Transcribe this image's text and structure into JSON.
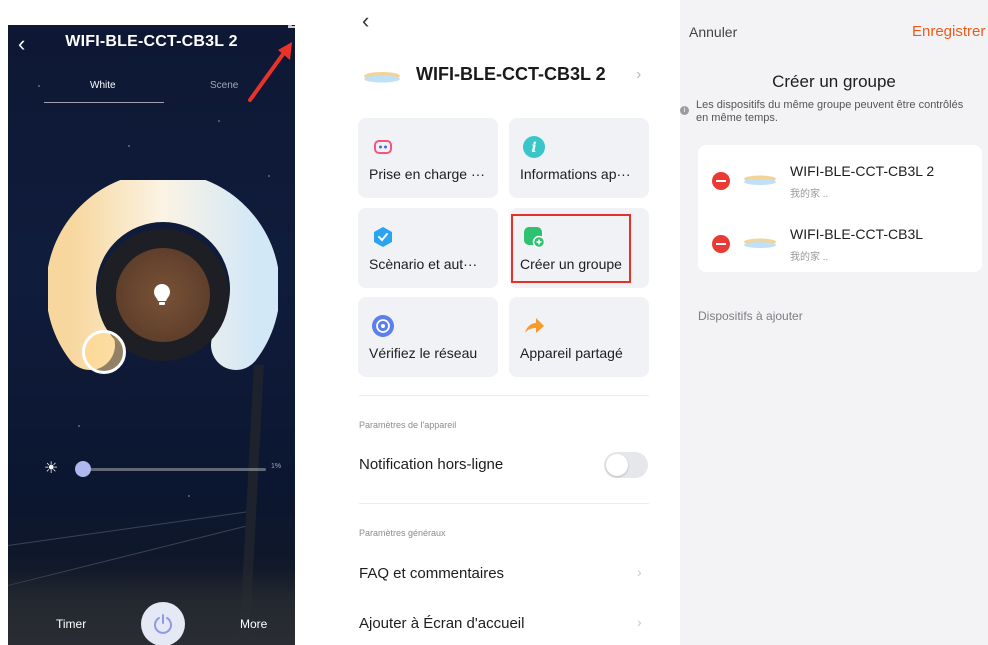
{
  "control": {
    "title": "WIFI-BLE-CCT-CB3L 2",
    "tabs": [
      {
        "label": "White"
      },
      {
        "label": "Scene"
      }
    ],
    "brightness_value": "1%",
    "brightness_fraction": 0.01,
    "timer_label": "Timer",
    "more_label": "More"
  },
  "device": {
    "title": "WIFI-BLE-CCT-CB3L 2",
    "tiles": [
      {
        "label": "Prise en charge ···",
        "icon": "speaker-icon",
        "color": "#f4567e"
      },
      {
        "label": "Informations ap···",
        "icon": "info-icon",
        "color": "#39c6c9"
      },
      {
        "label": "Scènario et aut···",
        "icon": "scenario-icon",
        "color": "#2aa4f0"
      },
      {
        "label": "Créer un groupe",
        "icon": "group-add-icon",
        "color": "#2dc26f"
      },
      {
        "label": "Vérifiez le réseau",
        "icon": "network-icon",
        "color": "#5b7ff0"
      },
      {
        "label": "Appareil partagé",
        "icon": "share-icon",
        "color": "#f59a2b"
      }
    ],
    "section_device": "Paramètres de l'appareil",
    "offline_notification": "Notification hors-ligne",
    "offline_enabled": false,
    "section_general": "Paramètres généraux",
    "faq": "FAQ et commentaires",
    "add_home": "Ajouter à Écran d'accueil"
  },
  "group": {
    "cancel": "Annuler",
    "save": "Enregistrer",
    "title": "Créer un groupe",
    "description": "Les dispositifs du même groupe peuvent être contrôlés en même temps.",
    "members": [
      {
        "name": "WIFI-BLE-CCT-CB3L 2",
        "home": "我的家 .."
      },
      {
        "name": "WIFI-BLE-CCT-CB3L",
        "home": "我的家 .."
      }
    ],
    "to_add": "Dispositifs à ajouter"
  },
  "colors": {
    "accent_red": "#e3322a",
    "save_orange": "#ef5a1a",
    "remove_red": "#ea3a36"
  }
}
